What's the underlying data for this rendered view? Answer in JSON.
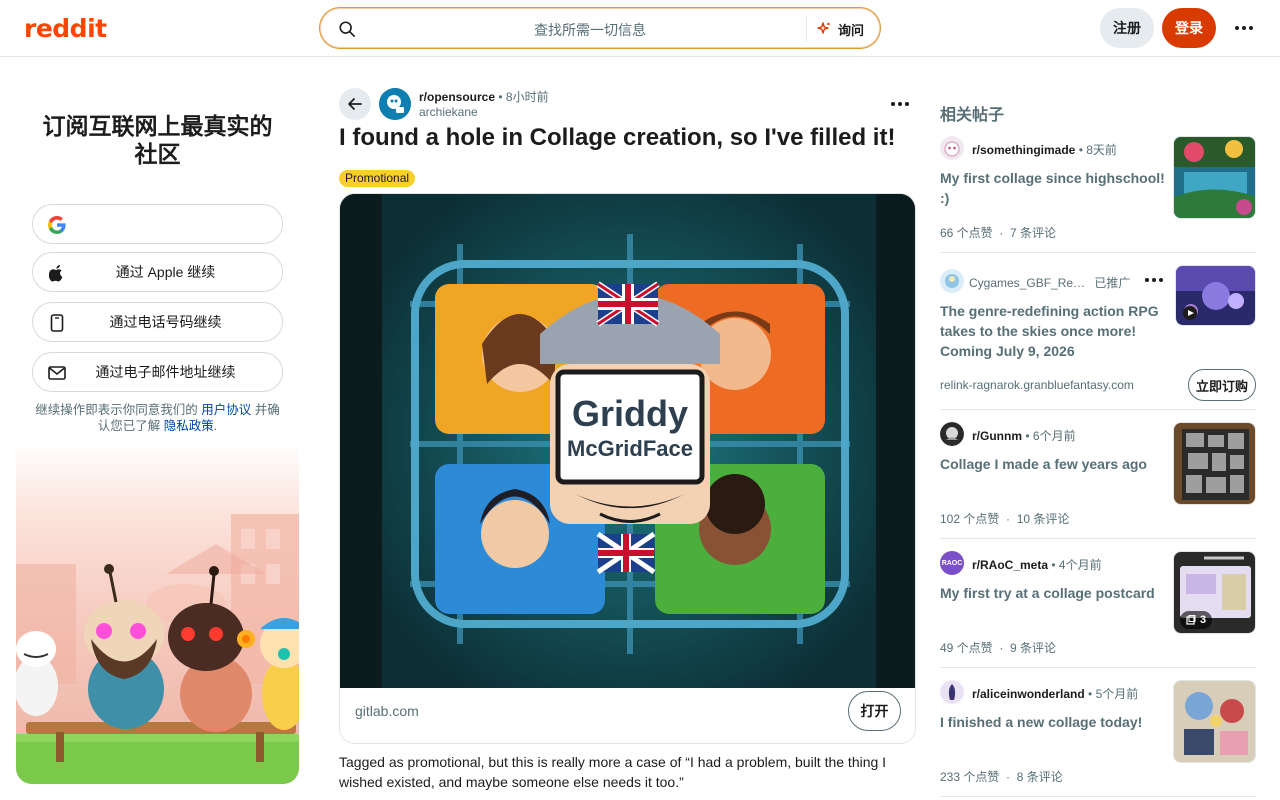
{
  "header": {
    "logo": "reddit",
    "search_placeholder": "查找所需一切信息",
    "ask_label": "询问",
    "signup_label": "注册",
    "login_label": "登录"
  },
  "left": {
    "title": "订阅互联网上最真实的社区",
    "auth": [
      {
        "icon": "google-icon",
        "label": ""
      },
      {
        "icon": "apple-icon",
        "label": "通过 Apple 继续"
      },
      {
        "icon": "phone-icon",
        "label": "通过电话号码继续"
      },
      {
        "icon": "mail-icon",
        "label": "通过电子邮件地址继续"
      }
    ],
    "terms_prefix": "继续操作即表示你同意我们的",
    "terms_link": "用户协议",
    "terms_middle": "并确认您已了解",
    "privacy_link": "隐私政策",
    "terms_suffix": "."
  },
  "post": {
    "subreddit": "r/opensource",
    "time": "8小时前",
    "author": "archiekane",
    "title": "I found a hole in Collage creation, so I've filled it!",
    "flair": "Promotional",
    "image_text_1": "Griddy",
    "image_text_2": "McGridFace",
    "domain": "gitlab.com",
    "open_label": "打开",
    "body": "Tagged as promotional, but this is really more a case of “I had a problem, built the thing I wished existed, and maybe someone else needs it too.”"
  },
  "related": {
    "title": "相关帖子",
    "items": [
      {
        "subreddit": "r/somethingimade",
        "time": "8天前",
        "title": "My first collage since highschool! :)",
        "votes": "66 个点赞",
        "comments": "7 条评论"
      },
      {
        "advertiser": "Cygames_GBF_Re…",
        "promoted": "已推广",
        "title": "The genre-redefining action RPG takes to the skies once more! Coming July 9, 2026",
        "url": "relink-ragnarok.granbluefantasy.com",
        "cta": "立即订购"
      },
      {
        "subreddit": "r/Gunnm",
        "time": "6个月前",
        "title": "Collage I made a few years ago",
        "votes": "102 个点赞",
        "comments": "10 条评论"
      },
      {
        "subreddit": "r/RAoC_meta",
        "time": "4个月前",
        "title": "My first try at a collage postcard",
        "votes": "49 个点赞",
        "comments": "9 条评论",
        "gallery_count": "3",
        "avatar_text": "RAOC"
      },
      {
        "subreddit": "r/aliceinwonderland",
        "time": "5个月前",
        "title": "I finished a new collage today!",
        "votes": "233 个点赞",
        "comments": "8 条评论"
      }
    ]
  }
}
